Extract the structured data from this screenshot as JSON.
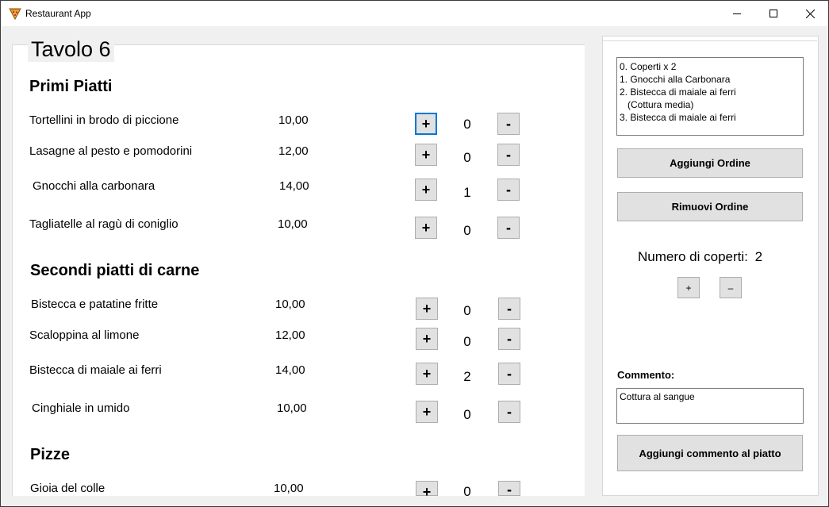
{
  "window": {
    "title": "Restaurant App",
    "icon": "pizza-slice-icon"
  },
  "table": {
    "title": "Tavolo 6"
  },
  "sections": [
    {
      "title": "Primi Piatti",
      "dishes": [
        {
          "name": "Tortellini in brodo di piccione",
          "price": "10,00",
          "qty": "0"
        },
        {
          "name": "Lasagne al pesto e pomodorini",
          "price": "12,00",
          "qty": "0"
        },
        {
          "name": "Gnocchi alla carbonara",
          "price": "14,00",
          "qty": "1"
        },
        {
          "name": "Tagliatelle al ragù di coniglio",
          "price": "10,00",
          "qty": "0"
        }
      ]
    },
    {
      "title": "Secondi piatti di carne",
      "dishes": [
        {
          "name": "Bistecca e patatine fritte",
          "price": "10,00",
          "qty": "0"
        },
        {
          "name": "Scaloppina al limone",
          "price": "12,00",
          "qty": "0"
        },
        {
          "name": "Bistecca di maiale ai ferri",
          "price": "14,00",
          "qty": "2"
        },
        {
          "name": "Cinghiale in umido",
          "price": "10,00",
          "qty": "0"
        }
      ]
    },
    {
      "title": "Pizze",
      "dishes": [
        {
          "name": "Gioia del colle",
          "price": "10,00",
          "qty": "0"
        }
      ]
    }
  ],
  "buttons": {
    "plus": "+",
    "minus": "-",
    "small_plus": "+",
    "small_minus": "–"
  },
  "orders": {
    "items": [
      "0. Coperti x 2",
      "1. Gnocchi alla Carbonara",
      "2. Bistecca di maiale ai ferri",
      "   (Cottura media)",
      "3. Bistecca di maiale ai ferri"
    ],
    "add_label": "Aggiungi Ordine",
    "remove_label": "Rimuovi Ordine"
  },
  "covers": {
    "label": "Numero di coperti:",
    "value": "2"
  },
  "comment": {
    "label": "Commento:",
    "value": "Cottura al sangue",
    "button_label": "Aggiungi commento al piatto"
  }
}
